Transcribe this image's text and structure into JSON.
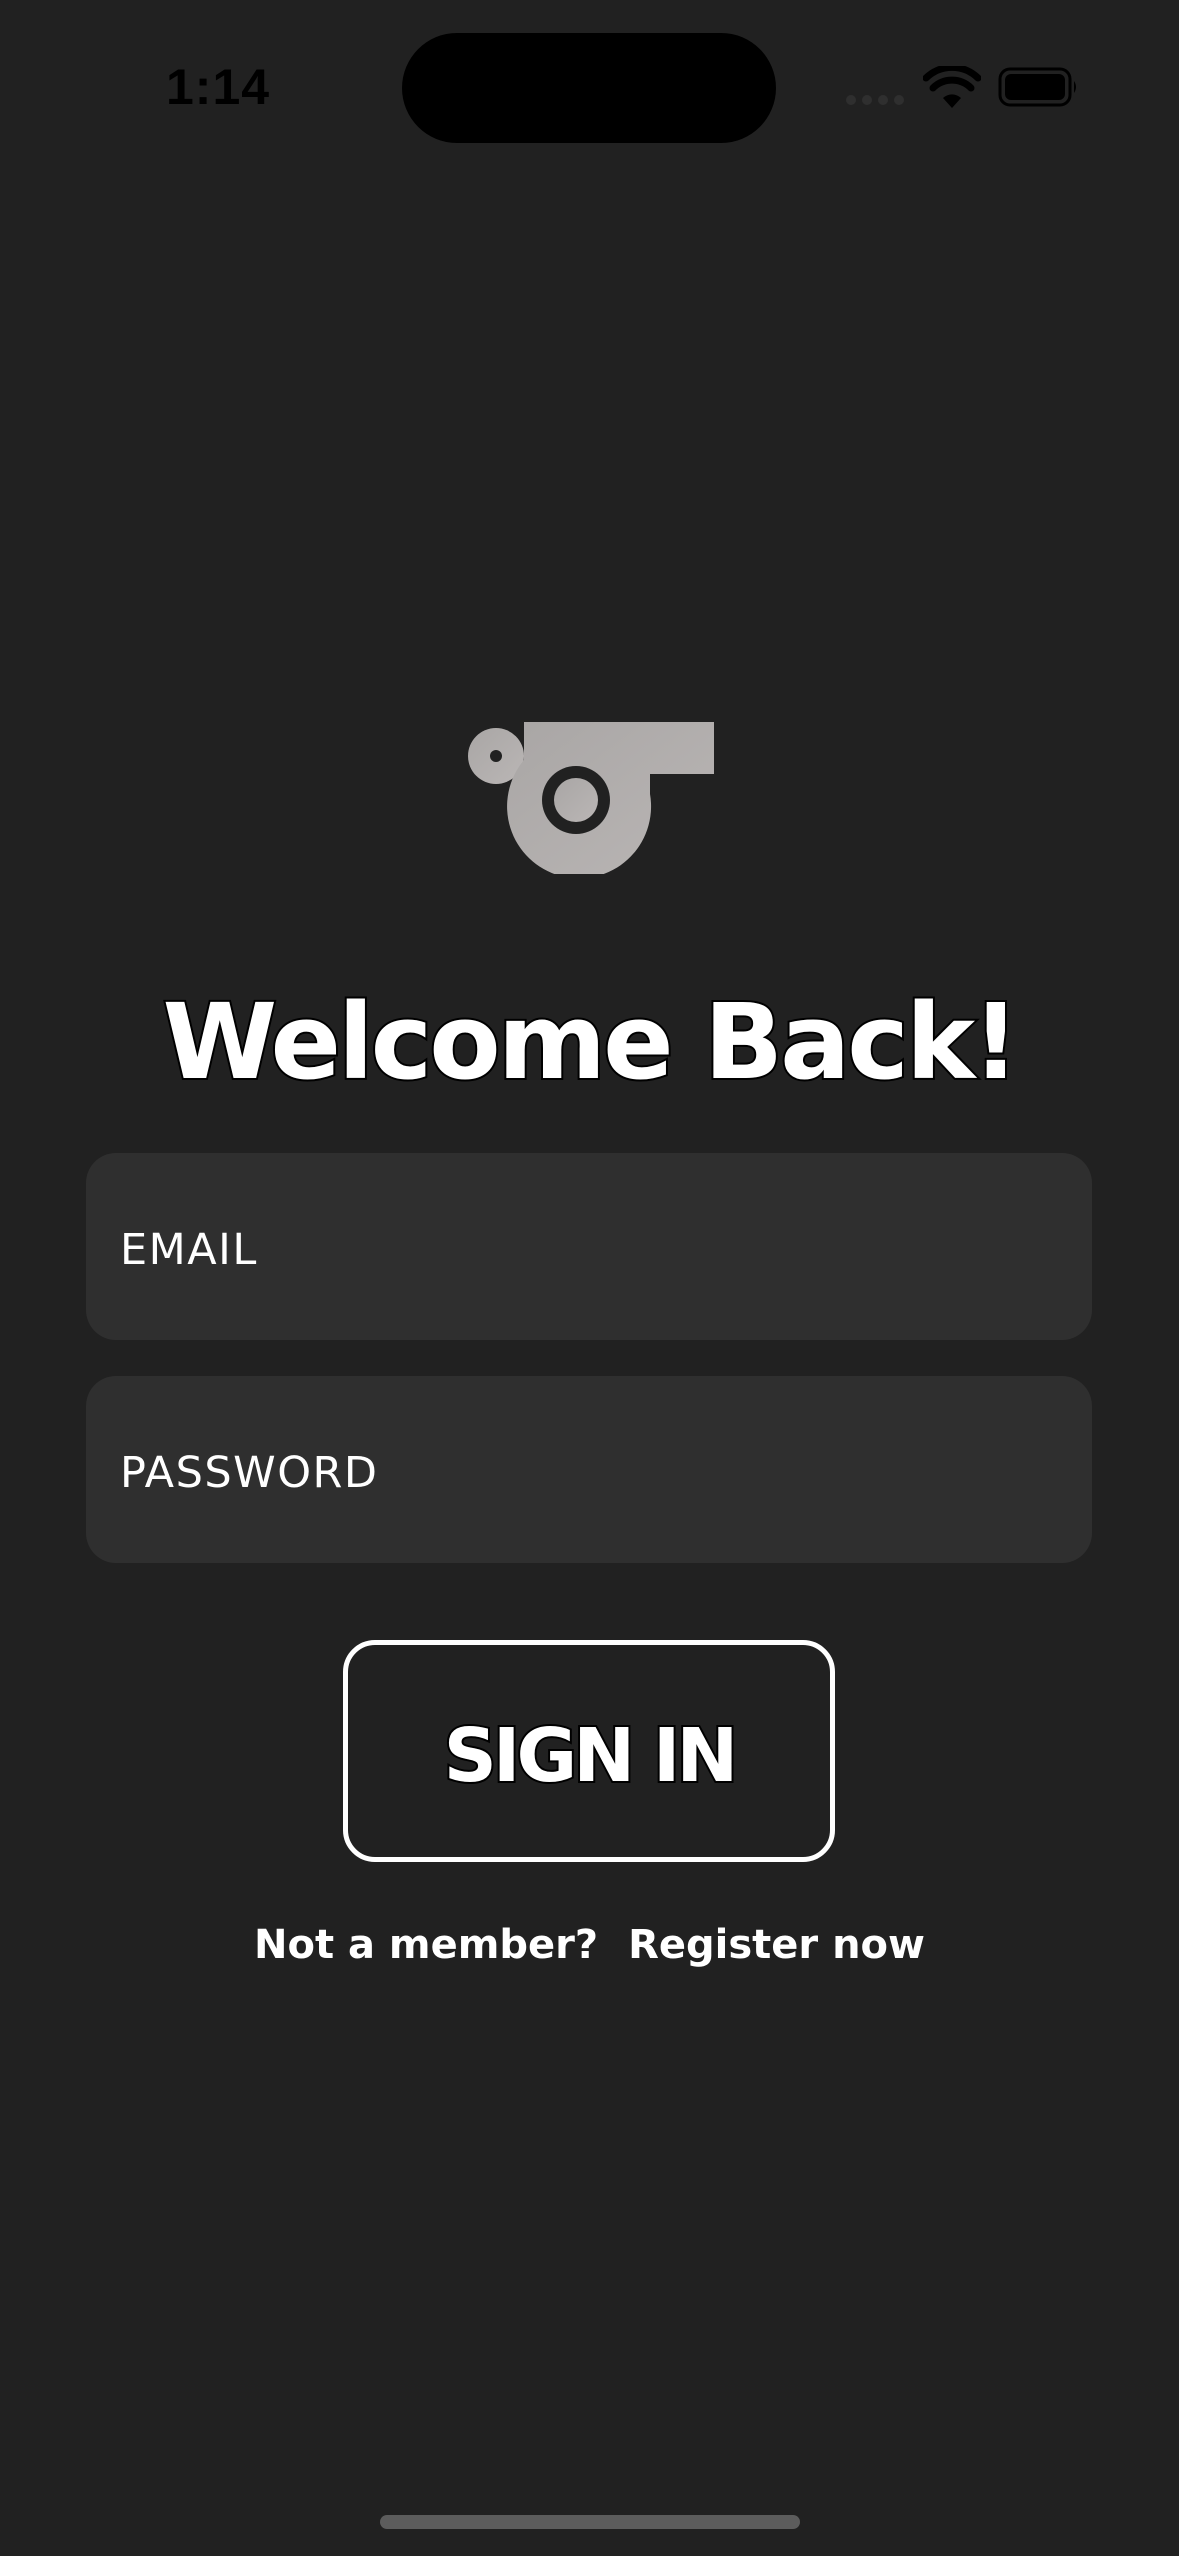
{
  "status_bar": {
    "time": "1:14"
  },
  "logo": {
    "icon": "whistle-icon",
    "color": "#B5B1B0"
  },
  "title": "Welcome Back!",
  "form": {
    "email_placeholder": "EMAIL",
    "password_placeholder": "PASSWORD",
    "sign_in_label": "SIGN IN"
  },
  "register": {
    "prompt": "Not a member?",
    "link": "Register now"
  },
  "colors": {
    "background": "#212121",
    "input_background": "#2F2F2F",
    "text": "#FFFFFF"
  }
}
